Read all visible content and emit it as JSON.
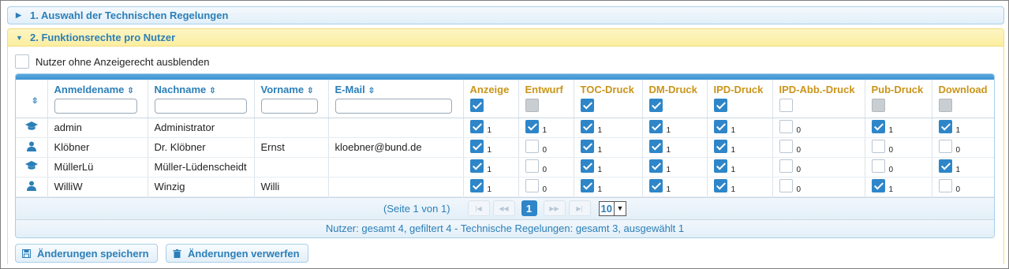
{
  "sections": {
    "section1_title": "1. Auswahl der Technischen Regelungen",
    "section2_title": "2. Funktionsrechte pro Nutzer"
  },
  "hide_option": {
    "label": "Nutzer ohne Anzeigerecht ausblenden",
    "checked": false
  },
  "grid": {
    "text_columns": [
      "Anmeldename",
      "Nachname",
      "Vorname",
      "E-Mail"
    ],
    "perm_columns": [
      {
        "label": "Anzeige",
        "header_state": "on"
      },
      {
        "label": "Entwurf",
        "header_state": "disabled"
      },
      {
        "label": "TOC-Druck",
        "header_state": "on"
      },
      {
        "label": "DM-Druck",
        "header_state": "on"
      },
      {
        "label": "IPD-Druck",
        "header_state": "on"
      },
      {
        "label": "IPD-Abb.-Druck",
        "header_state": "off"
      },
      {
        "label": "Pub-Druck",
        "header_state": "disabled"
      },
      {
        "label": "Download",
        "header_state": "disabled"
      }
    ],
    "rows": [
      {
        "icon": "graduation-cap-icon",
        "login": "admin",
        "lastname": "Administrator",
        "firstname": "",
        "email": "",
        "perms": [
          1,
          1,
          1,
          1,
          1,
          0,
          1,
          1
        ]
      },
      {
        "icon": "user-icon",
        "login": "Klöbner",
        "lastname": "Dr. Klöbner",
        "firstname": "Ernst",
        "email": "kloebner@bund.de",
        "perms": [
          1,
          0,
          1,
          1,
          1,
          0,
          0,
          0
        ]
      },
      {
        "icon": "graduation-cap-icon",
        "login": "MüllerLü",
        "lastname": "Müller-Lüdenscheidt",
        "firstname": "",
        "email": "",
        "perms": [
          1,
          0,
          1,
          1,
          1,
          0,
          0,
          1
        ]
      },
      {
        "icon": "user-icon",
        "login": "WilliW",
        "lastname": "Winzig",
        "firstname": "Willi",
        "email": "",
        "perms": [
          1,
          0,
          1,
          1,
          1,
          0,
          1,
          0
        ]
      }
    ]
  },
  "pager": {
    "page_info": "(Seite 1 von 1)",
    "current_page": "1",
    "page_size": "10"
  },
  "summary": "Nutzer: gesamt 4, gefiltert 4 - Technische Regelungen: gesamt 3, ausgewählt 1",
  "buttons": {
    "save": "Änderungen speichern",
    "discard": "Änderungen verwerfen"
  },
  "colors": {
    "accent": "#2e86c9",
    "link": "#2b7fb8",
    "perm_header": "#c9951a",
    "active_section": "#fbeea0"
  }
}
